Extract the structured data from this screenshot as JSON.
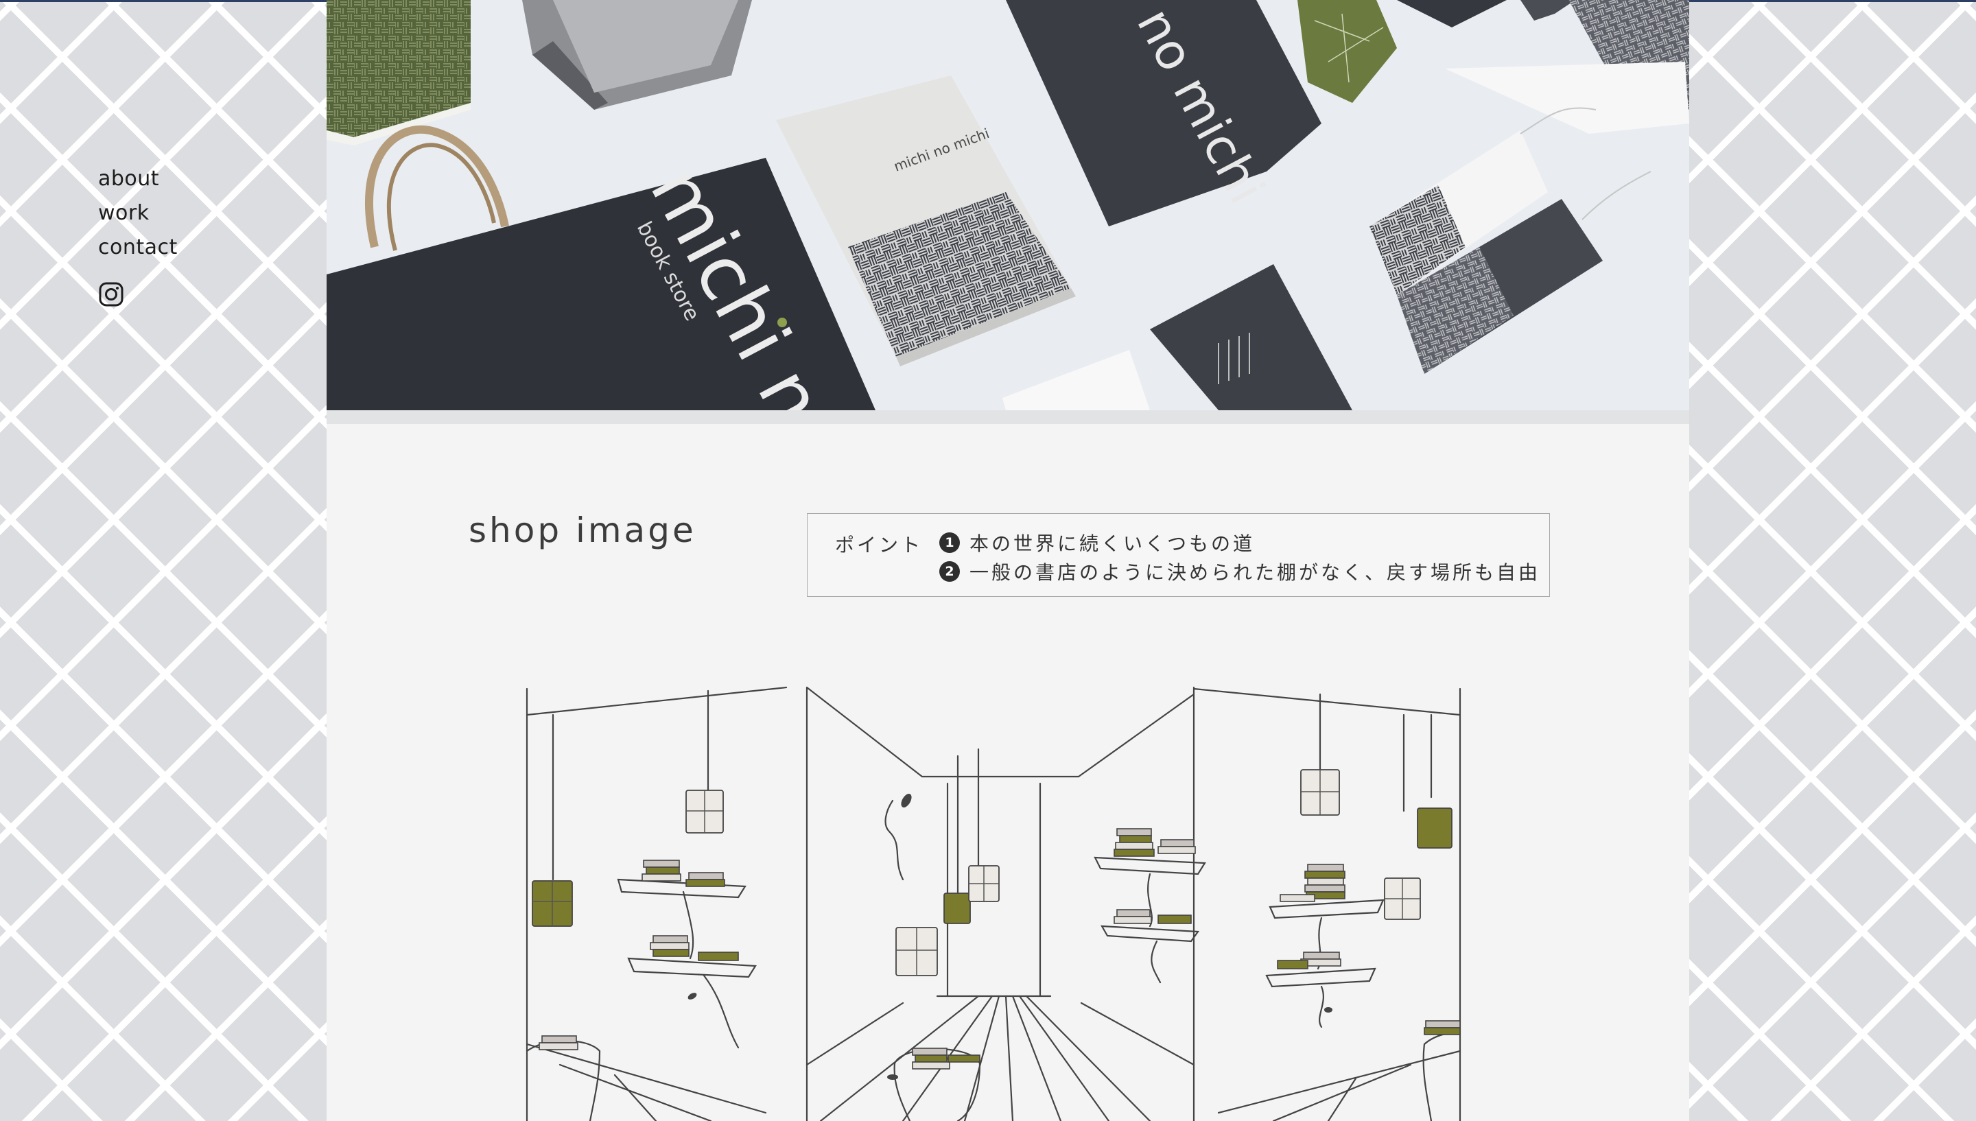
{
  "nav": {
    "items": [
      "about",
      "work",
      "contact"
    ],
    "instagram_icon": "instagram-icon"
  },
  "hero": {
    "brand_text": "michi no michi",
    "tagline": "book store",
    "colors": {
      "dark": "#3a3d44",
      "olive": "#6b7a3e",
      "paper": "#e8e8e6"
    }
  },
  "shop": {
    "title": "shop image",
    "point_label": "ポイント",
    "points": [
      {
        "num": "1",
        "text": "本の世界に続くいくつもの道"
      },
      {
        "num": "2",
        "text": "一般の書店のように決められた棚がなく、戻す場所も自由"
      }
    ],
    "colors": {
      "olive": "#7b7b2e",
      "line": "#444444",
      "book": "#c9c4bf"
    }
  }
}
